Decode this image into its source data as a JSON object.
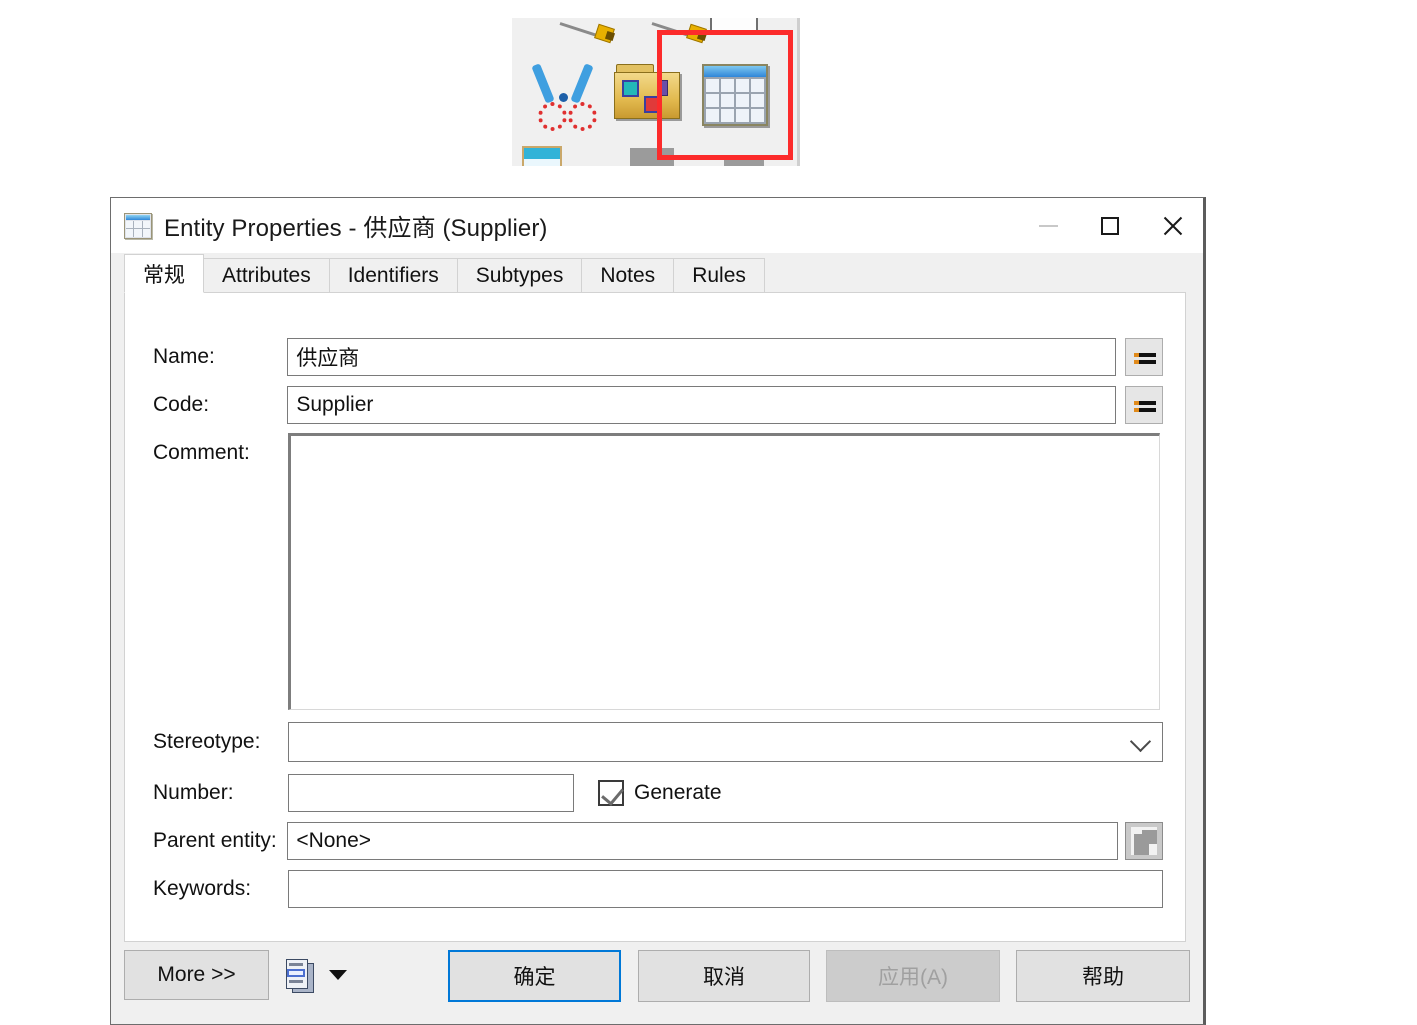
{
  "toolbar": {
    "icons": [
      {
        "name": "pencil-icon-1"
      },
      {
        "name": "pencil-icon-2"
      },
      {
        "name": "document-icon-partial"
      },
      {
        "name": "scissors-icon"
      },
      {
        "name": "folder-package-icon"
      },
      {
        "name": "entity-table-icon"
      },
      {
        "name": "blue-document-icon"
      },
      {
        "name": "gray-shape-icon"
      }
    ],
    "highlight_color": "#fc2b2b",
    "highlighted_icon": "entity-table-icon"
  },
  "dialog": {
    "title": "Entity Properties - 供应商 (Supplier)",
    "title_icon": "entity-table-icon",
    "window_controls": {
      "minimize": "—",
      "maximize": "□",
      "close": "✕",
      "minimize_disabled": true
    },
    "tabs": [
      {
        "label": "常规",
        "active": true
      },
      {
        "label": "Attributes",
        "active": false
      },
      {
        "label": "Identifiers",
        "active": false
      },
      {
        "label": "Subtypes",
        "active": false
      },
      {
        "label": "Notes",
        "active": false
      },
      {
        "label": "Rules",
        "active": false
      }
    ],
    "fields": {
      "name": {
        "label": "Name:",
        "value": "供应商",
        "placeholder": ""
      },
      "code": {
        "label": "Code:",
        "value": "Supplier",
        "placeholder": ""
      },
      "comment": {
        "label": "Comment:",
        "value": "",
        "placeholder": ""
      },
      "stereotype": {
        "label": "Stereotype:",
        "value": "",
        "placeholder": ""
      },
      "number": {
        "label": "Number:",
        "value": "",
        "placeholder": ""
      },
      "generate": {
        "label": "Generate",
        "checked": true
      },
      "parent_entity": {
        "label": "Parent entity:",
        "value": "<None>",
        "placeholder": ""
      },
      "keywords": {
        "label": "Keywords:",
        "value": "",
        "placeholder": ""
      }
    },
    "footer": {
      "more": "More >>",
      "report_icon": "print-report-icon",
      "report_dropdown": "chevron-down-icon",
      "ok": "确定",
      "cancel": "取消",
      "apply": "应用(A)",
      "apply_disabled": true,
      "help": "帮助",
      "default_button": "确定",
      "accent_color": "#0078d7"
    }
  }
}
